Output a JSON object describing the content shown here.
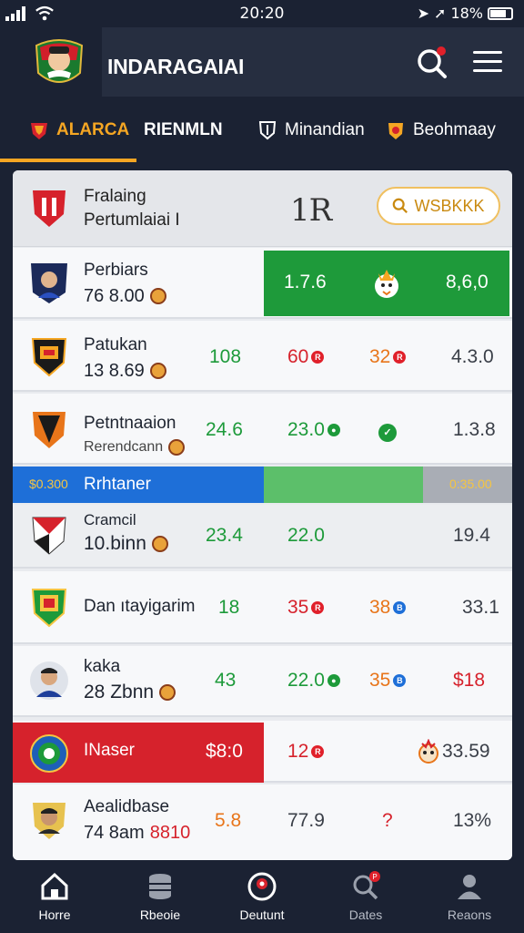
{
  "status_bar": {
    "time": "20:20",
    "battery": "18%"
  },
  "header": {
    "title": "INDARAGAIAI"
  },
  "tabs": [
    {
      "label": "ALARCA",
      "active": true,
      "icon": "team-crest-icon"
    },
    {
      "label": "RIENMLN",
      "active": false,
      "icon": ""
    },
    {
      "label": "Minandian",
      "active": false,
      "icon": "shield-icon"
    },
    {
      "label": "Beohmaay",
      "active": false,
      "icon": "badge-icon"
    }
  ],
  "league": {
    "name": "Fralaing",
    "subtitle": "Pertumlaiai I",
    "number": "1R",
    "watch_label": "WSBKKK"
  },
  "rows": [
    {
      "name": "Perbiars",
      "meta": "76 8.00",
      "c1": "1.7.6",
      "c3": "8,6,0"
    },
    {
      "name": "Patukan",
      "meta": "13 8.69",
      "c1": "108",
      "c2": "60",
      "c3": "32",
      "c4": "4.3.0"
    },
    {
      "name": "Petntnaaion",
      "meta": "Rerendcann",
      "c1": "24.6",
      "c2": "23.0",
      "c4": "1.3.8"
    },
    {
      "name": "Rrhtaner",
      "left_label": "$0.300",
      "right_label": "0:35.00"
    },
    {
      "name": "Cramcil",
      "meta": "10.binn",
      "c1": "23.4",
      "c2": "22.0",
      "c4": "19.4"
    },
    {
      "name": "Dan ıtayigarim",
      "c1": "18",
      "c2": "35",
      "c3": "38",
      "c4": "33.1"
    },
    {
      "name": "kaka",
      "meta": "28 Zbnn",
      "c1": "43",
      "c2": "22.0",
      "c3": "35",
      "c4": "$18"
    },
    {
      "name": "INaser",
      "price": "$8:0",
      "c2": "12",
      "c4": "33.59"
    },
    {
      "name": "Aealidbase",
      "meta": "74 8am",
      "meta_red": "8810",
      "c1": "5.8",
      "c2": "77.9",
      "c3": "?",
      "c4": "13%"
    }
  ],
  "footer_nav": [
    {
      "label": "Horre",
      "icon": "home-icon"
    },
    {
      "label": "Rbeoie",
      "icon": "database-icon"
    },
    {
      "label": "Deutunt",
      "icon": "ball-icon"
    },
    {
      "label": "Dates",
      "icon": "search-icon"
    },
    {
      "label": "Reaons",
      "icon": "user-icon"
    }
  ],
  "colors": {
    "accent": "#f5a623",
    "green": "#1d9a3a",
    "red": "#d6222c",
    "blue": "#1e6fd8",
    "bg": "#1b2233"
  }
}
